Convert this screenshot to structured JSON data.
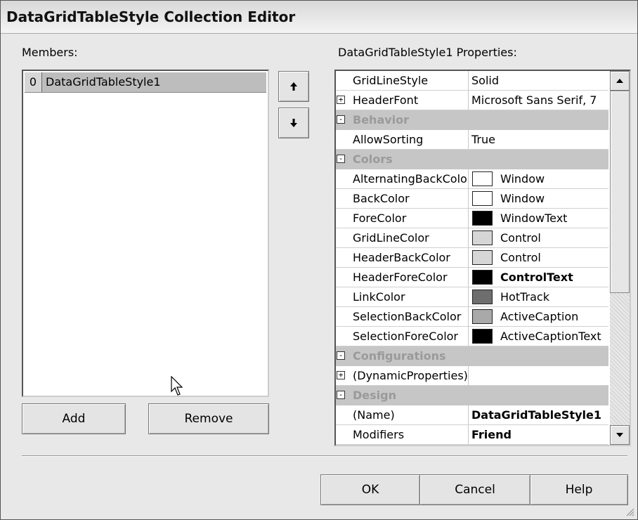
{
  "window": {
    "title": "DataGridTableStyle Collection Editor"
  },
  "members": {
    "label": "Members:",
    "items": [
      {
        "index": "0",
        "name": "DataGridTableStyle1"
      }
    ],
    "add_label": "Add",
    "remove_label": "Remove",
    "move_up_icon": "arrow-up-icon",
    "move_down_icon": "arrow-down-icon"
  },
  "properties": {
    "label": "DataGridTableStyle1 Properties:",
    "rows": [
      {
        "type": "prop",
        "expander": "",
        "name": "GridLineStyle",
        "value": "Solid"
      },
      {
        "type": "prop",
        "expander": "+",
        "name": "HeaderFont",
        "value": "Microsoft Sans Serif, 7"
      },
      {
        "type": "cat",
        "expander": "-",
        "name": "Behavior"
      },
      {
        "type": "prop",
        "expander": "",
        "name": "AllowSorting",
        "value": "True"
      },
      {
        "type": "cat",
        "expander": "-",
        "name": "Colors"
      },
      {
        "type": "color",
        "name": "AlternatingBackColor",
        "value": "Window",
        "swatch": "#ffffff"
      },
      {
        "type": "color",
        "name": "BackColor",
        "value": "Window",
        "swatch": "#ffffff"
      },
      {
        "type": "color",
        "name": "ForeColor",
        "value": "WindowText",
        "swatch": "#000000"
      },
      {
        "type": "color",
        "name": "GridLineColor",
        "value": "Control",
        "swatch": "#d6d6d6"
      },
      {
        "type": "color",
        "name": "HeaderBackColor",
        "value": "Control",
        "swatch": "#d6d6d6"
      },
      {
        "type": "color",
        "name": "HeaderForeColor",
        "value": "ControlText",
        "swatch": "#000000",
        "bold": true
      },
      {
        "type": "color",
        "name": "LinkColor",
        "value": "HotTrack",
        "swatch": "#6e6e6e"
      },
      {
        "type": "color",
        "name": "SelectionBackColor",
        "value": "ActiveCaption",
        "swatch": "#a9a9a9"
      },
      {
        "type": "color",
        "name": "SelectionForeColor",
        "value": "ActiveCaptionText",
        "swatch": "#000000"
      },
      {
        "type": "cat",
        "expander": "-",
        "name": "Configurations"
      },
      {
        "type": "prop",
        "expander": "+",
        "name": "(DynamicProperties)",
        "value": ""
      },
      {
        "type": "cat",
        "expander": "-",
        "name": "Design"
      },
      {
        "type": "prop",
        "expander": "",
        "name": "(Name)",
        "value": "DataGridTableStyle1",
        "bold": true
      },
      {
        "type": "prop",
        "expander": "",
        "name": "Modifiers",
        "value": "Friend",
        "bold": true
      }
    ]
  },
  "footer": {
    "ok_label": "OK",
    "cancel_label": "Cancel",
    "help_label": "Help"
  }
}
